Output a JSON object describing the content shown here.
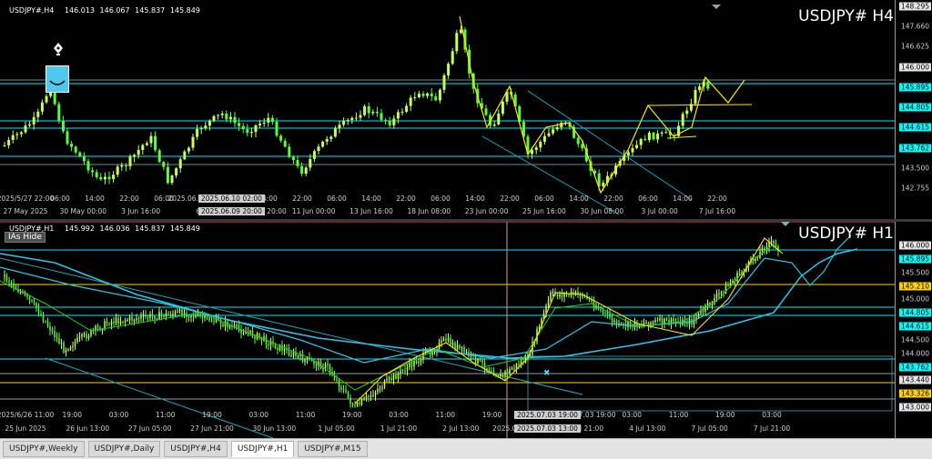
{
  "h4": {
    "info": {
      "symbol": "USDJPY#,H4",
      "open": "146.013",
      "high": "146.067",
      "low": "145.837",
      "close": "145.849"
    },
    "title": "USDJPY# H4",
    "prices": [
      {
        "text": "148.295",
        "style": "wh"
      },
      {
        "text": "147.660",
        "style": ""
      },
      {
        "text": "146.625",
        "style": ""
      },
      {
        "text": "146.000",
        "style": "wh"
      },
      {
        "text": "145.895",
        "style": "hl"
      },
      {
        "text": "144.805",
        "style": "hl"
      },
      {
        "text": "144.615",
        "style": "hl"
      },
      {
        "text": "143.762",
        "style": "hl"
      },
      {
        "text": "143.500",
        "style": ""
      },
      {
        "text": "142.755",
        "style": ""
      }
    ],
    "time_top": [
      "2025/5/27 22:00",
      "06:00",
      "14:00",
      "22:00",
      "06:00",
      "2025.06.10 02:00",
      "06:00",
      "14:00",
      "22:00",
      "06:00",
      "14:00",
      "22:00",
      "06:00",
      "14:00",
      "22:00",
      "06:00",
      "14:00",
      "22:00",
      "06:00",
      "14:00",
      "22:00"
    ],
    "time_bottom": [
      "27 May 2025",
      "30 May 00:00",
      "3 Jun 16:00",
      "6",
      "2025.06.09 20:00",
      "11 Jun 00:00",
      "13 Jun 16:00",
      "18 Jun 08:00",
      "23 Jun 00:00",
      "25 Jun 16:00",
      "30 Jun 08:00",
      "3 Jul 00:00",
      "7 Jul 16:00"
    ]
  },
  "h1": {
    "info": {
      "symbol": "USDJPY#,H1",
      "open": "145.992",
      "high": "146.036",
      "low": "145.837",
      "close": "145.849"
    },
    "title": "USDJPY# H1",
    "ias_label": "IAs Hide",
    "prices": [
      {
        "text": "146.000",
        "style": "wh"
      },
      {
        "text": "145.895",
        "style": "hl"
      },
      {
        "text": "145.500",
        "style": ""
      },
      {
        "text": "145.210",
        "style": "yl"
      },
      {
        "text": "145.000",
        "style": ""
      },
      {
        "text": "144.805",
        "style": "hl"
      },
      {
        "text": "144.615",
        "style": "hl"
      },
      {
        "text": "144.500",
        "style": ""
      },
      {
        "text": "144.000",
        "style": ""
      },
      {
        "text": "143.762",
        "style": "hl"
      },
      {
        "text": "143.440",
        "style": "wh"
      },
      {
        "text": "143.326",
        "style": "yl"
      },
      {
        "text": "143.000",
        "style": "wh"
      }
    ],
    "time_top": [
      "2025/6/26 11:00",
      "19:00",
      "03:00",
      "11:00",
      "19:00",
      "03:00",
      "11:00",
      "19:00",
      "03:00",
      "11:00",
      "19:00",
      "03:00",
      "2025.07.03 19:00",
      "03:00",
      "11:00",
      "19:00",
      "03:00"
    ],
    "time_bottom": [
      "25 Jun 2025",
      "26 Jun 13:00",
      "27 Jun 05:00",
      "27 Jun 21:00",
      "30 Jun 13:00",
      "1 Jul 05:00",
      "1 Jul 21:00",
      "2 Jul 13:00",
      "2025.07.03 13:00",
      "3 Jul 21:00",
      "4 Jul 13:00",
      "7 Jul 05:00",
      "7 Jul 21:00"
    ]
  },
  "tabs": [
    {
      "label": "USDJPY#,Weekly",
      "active": false
    },
    {
      "label": "USDJPY#,Daily",
      "active": false
    },
    {
      "label": "USDJPY#,H4",
      "active": false
    },
    {
      "label": "USDJPY#,H1",
      "active": true
    },
    {
      "label": "USDJPY#,M15",
      "active": false
    }
  ],
  "colors": {
    "bull": "#c8ff5a",
    "bear": "#5cff3a",
    "trend": "#ffe600",
    "level": "#00e5ff",
    "ma_fast": "#22cc22",
    "ma_slow": "#2ec7e6"
  }
}
